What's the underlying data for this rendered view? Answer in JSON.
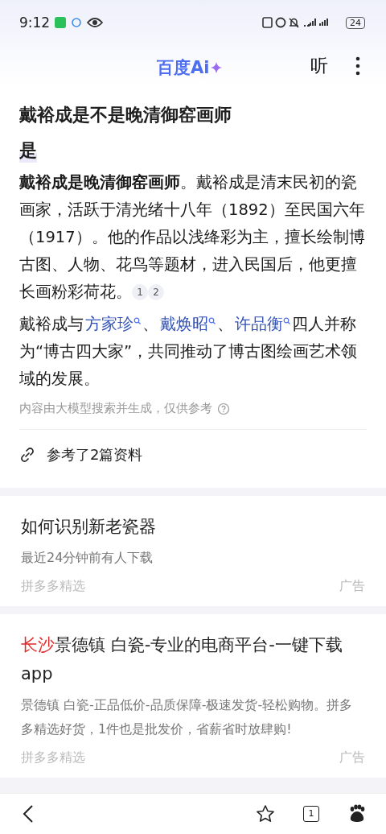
{
  "status_bar": {
    "time": "9:12",
    "battery": "24"
  },
  "header": {
    "logo": "百度Ai",
    "listen": "听"
  },
  "question": "戴裕成是不是晚清御窑画师",
  "answer": {
    "short": "是",
    "paragraph": "**戴裕成是晚清御窑画师**。戴裕成是清末民初的瓷画家，活跃于清光绪十八年（1892）至民国六年（1917）。他的作品以浅绛彩为主，擅长绘制博古图、人物、花鸟等题材，进入民国后，他更擅长画粉彩荷花。",
    "citations": [
      "1",
      "2"
    ],
    "paragraph2": [
      {
        "kind": "text",
        "text": "戴裕成与"
      },
      {
        "kind": "link",
        "text": "方家珍"
      },
      {
        "kind": "text",
        "text": "、"
      },
      {
        "kind": "link",
        "text": "戴焕昭"
      },
      {
        "kind": "text",
        "text": "、"
      },
      {
        "kind": "link",
        "text": "许品衡"
      },
      {
        "kind": "text",
        "text": "四人并称为“博古四大家”，共同推动了博古图绘画艺术领域的发展。"
      }
    ],
    "disclaimer": "内容由大模型搜索并生成，仅供参考",
    "references": "参考了2篇资料"
  },
  "ads": [
    {
      "title": "如何识别新老瓷器",
      "description": "最近24分钟前有人下载",
      "source": "拼多多精选",
      "tag": "广告"
    },
    {
      "location": "长沙",
      "title": "景德镇 白瓷-专业的电商平台-一键下载app",
      "description": "景德镇 白瓷-正品低价-品质保障-极速发货-轻松购物。拼多多精选好货，1件也是批发价，省薪省时放肆购!",
      "source": "拼多多精选",
      "tag": "广告"
    }
  ],
  "bottom_bar": {
    "tab_count": "1"
  }
}
